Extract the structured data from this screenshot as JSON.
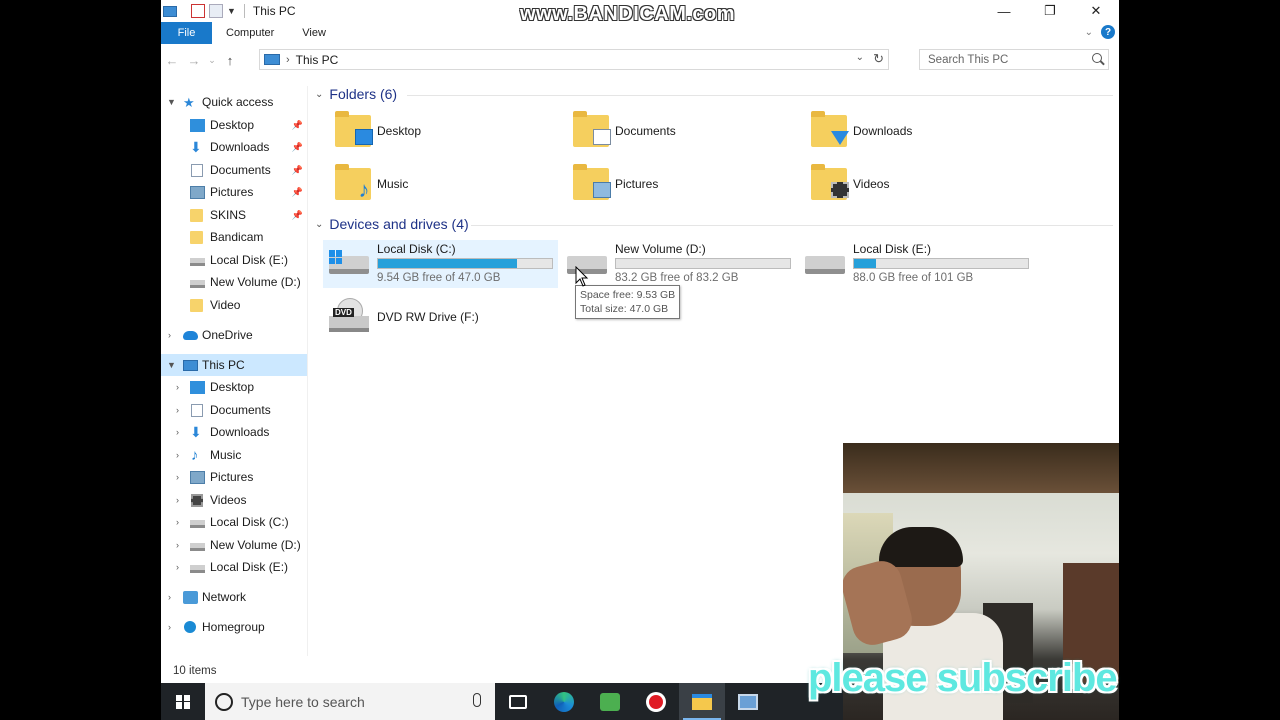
{
  "window": {
    "title": "This PC",
    "minimize": "—",
    "restore": "❐",
    "close": "✕"
  },
  "ribbon": {
    "tabs": [
      "File",
      "Computer",
      "View"
    ],
    "help": "?"
  },
  "address": {
    "path": "This PC",
    "search_placeholder": "Search This PC"
  },
  "nav": {
    "quick_access": "Quick access",
    "quick_items": [
      {
        "label": "Desktop",
        "pinned": true
      },
      {
        "label": "Downloads",
        "pinned": true
      },
      {
        "label": "Documents",
        "pinned": true
      },
      {
        "label": "Pictures",
        "pinned": true
      },
      {
        "label": "SKINS",
        "pinned": true
      },
      {
        "label": "Bandicam",
        "pinned": false
      },
      {
        "label": "Local Disk (E:)",
        "pinned": false
      },
      {
        "label": "New Volume (D:)",
        "pinned": false
      },
      {
        "label": "Video",
        "pinned": false
      }
    ],
    "onedrive": "OneDrive",
    "this_pc": "This PC",
    "pc_items": [
      "Desktop",
      "Documents",
      "Downloads",
      "Music",
      "Pictures",
      "Videos",
      "Local Disk (C:)",
      "New Volume (D:)",
      "Local Disk (E:)"
    ],
    "network": "Network",
    "homegroup": "Homegroup"
  },
  "content": {
    "folders_header": "Folders (6)",
    "folders": [
      "Desktop",
      "Documents",
      "Downloads",
      "Music",
      "Pictures",
      "Videos"
    ],
    "drives_header": "Devices and drives (4)",
    "drives": [
      {
        "name": "Local Disk (C:)",
        "free_text": "9.54 GB free of 47.0 GB",
        "used_fraction": 0.797
      },
      {
        "name": "New Volume (D:)",
        "free_text": "83.2 GB free of 83.2 GB",
        "used_fraction": 0.0
      },
      {
        "name": "Local Disk (E:)",
        "free_text": "88.0 GB free of 101 GB",
        "used_fraction": 0.129
      }
    ],
    "dvd": {
      "name": "DVD RW Drive (F:)",
      "badge": "DVD"
    },
    "tooltip": {
      "space_free": "Space free: 9.53 GB",
      "total_size": "Total size: 47.0 GB"
    }
  },
  "status": {
    "items": "10 items"
  },
  "taskbar": {
    "search_placeholder": "Type here to search"
  },
  "overlays": {
    "watermark": "www.BANDICAM.com",
    "subscribe": "please subscribe"
  },
  "colors": {
    "accent": "#1979ca",
    "selection": "#cce8ff",
    "drive_bar": "#26a0da"
  }
}
